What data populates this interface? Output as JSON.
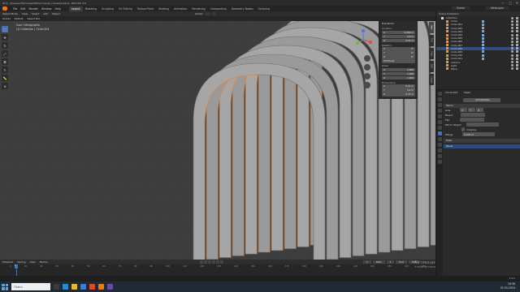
{
  "window": {
    "title": "\\D:\\[...]\\сцены\\Лестница\\02\\лестница_тоннеля.blend - Blender 3.6",
    "minimize": "—",
    "maximize": "□",
    "close": "✕"
  },
  "menu": {
    "items": [
      "File",
      "Edit",
      "Render",
      "Window",
      "Help"
    ],
    "workspaces": [
      "Layout",
      "Modeling",
      "Sculpting",
      "UV Editing",
      "Texture Paint",
      "Shading",
      "Animation",
      "Rendering",
      "Compositing",
      "Geometry Nodes",
      "Scripting"
    ],
    "active_workspace": "Layout",
    "scene": "Scene",
    "view_layer": "ViewLayer"
  },
  "viewport_header": {
    "mode": "Object Mode",
    "items": [
      "View",
      "Select",
      "Add",
      "Object"
    ],
    "orientation": "Global",
    "drag": "Select Box",
    "transform_space": "Global",
    "pivot": "Default"
  },
  "viewport": {
    "view_name": "User Orthographic",
    "collection_info": "(1) Collection | Circle.004"
  },
  "toolbar": {
    "tools": [
      "⬚",
      "✥",
      "↻",
      "⤢",
      "⧉",
      "✎",
      "📏",
      "⊕"
    ]
  },
  "n_panel": {
    "title": "Transform",
    "location_label": "Location:",
    "location": [
      [
        "X",
        "0.000 m"
      ],
      [
        "Y",
        "0.0 m"
      ],
      [
        "Z",
        "0.01 m"
      ]
    ],
    "rotation_label": "Rotation:",
    "rotation": [
      [
        "X",
        "0°"
      ],
      [
        "Y",
        "0°"
      ],
      [
        "Z",
        "0°"
      ]
    ],
    "mode": "XYZ Euler",
    "scale_label": "Scale:",
    "scale": [
      [
        "X",
        "1.000"
      ],
      [
        "Y",
        "1.000"
      ],
      [
        "Z",
        "1.000"
      ]
    ],
    "dimensions_label": "Dimensions:",
    "dimensions": [
      [
        "X",
        "0.21 m"
      ],
      [
        "Y",
        "0.2 m"
      ],
      [
        "Z",
        "0.23 m"
      ]
    ],
    "tabs": [
      "Item",
      "Tool",
      "View",
      "Edit",
      "Create"
    ]
  },
  "outliner": {
    "title": "Scene Collection",
    "items": [
      {
        "name": "Collection",
        "selected": false
      },
      {
        "name": "Circle",
        "selected": false
      },
      {
        "name": "Circle.001",
        "selected": false
      },
      {
        "name": "Circle.002",
        "selected": false
      },
      {
        "name": "Circle.003",
        "selected": false
      },
      {
        "name": "Circle.004",
        "selected": false
      },
      {
        "name": "Circle.005",
        "selected": false
      },
      {
        "name": "Circle.006",
        "selected": false
      },
      {
        "name": "Circle.007",
        "selected": false
      },
      {
        "name": "Circle.008",
        "selected": true
      },
      {
        "name": "Circle.009",
        "selected": false
      },
      {
        "name": "Circle.010",
        "selected": false
      },
      {
        "name": "Circle.011",
        "selected": false
      },
      {
        "name": "Camera",
        "selected": false
      },
      {
        "name": "Light",
        "selected": false
      },
      {
        "name": "Plane",
        "selected": false
      }
    ]
  },
  "properties": {
    "object": "Circle.004",
    "mesh": "Mesh",
    "modifiers_label": "Add Modifier",
    "modifier_name": "Mirror",
    "axis_label": "Axis",
    "bisect_label": "Bisect",
    "flip_label": "Flip",
    "mirror_object_label": "Mirror Object",
    "clipping_label": "Clipping",
    "merge_label": "Merge",
    "merge_value": "0.001 m",
    "data_label": "Data",
    "solidify_label": "Bevel"
  },
  "timeline": {
    "header_items": [
      "Playback",
      "Keying",
      "View",
      "Marker"
    ],
    "ruler": [
      "0",
      "10",
      "20",
      "30",
      "40",
      "50",
      "60",
      "70",
      "80",
      "90",
      "100",
      "110",
      "120",
      "130",
      "140",
      "150",
      "160",
      "170",
      "180",
      "190",
      "200",
      "210",
      "220",
      "230",
      "240",
      "250"
    ],
    "current_frame": "1",
    "start_label": "Start",
    "start": "1",
    "end_label": "End",
    "end": "250"
  },
  "statusbar": {
    "version": "3.6.0"
  },
  "windows_activation": {
    "title": "Активация Windows",
    "text": "Чтобы активировать Windows, перейдите в раздел \"Параметры\"."
  },
  "taskbar": {
    "search_placeholder": "Поиск",
    "time": "16:38",
    "date": "05.05.2024"
  }
}
